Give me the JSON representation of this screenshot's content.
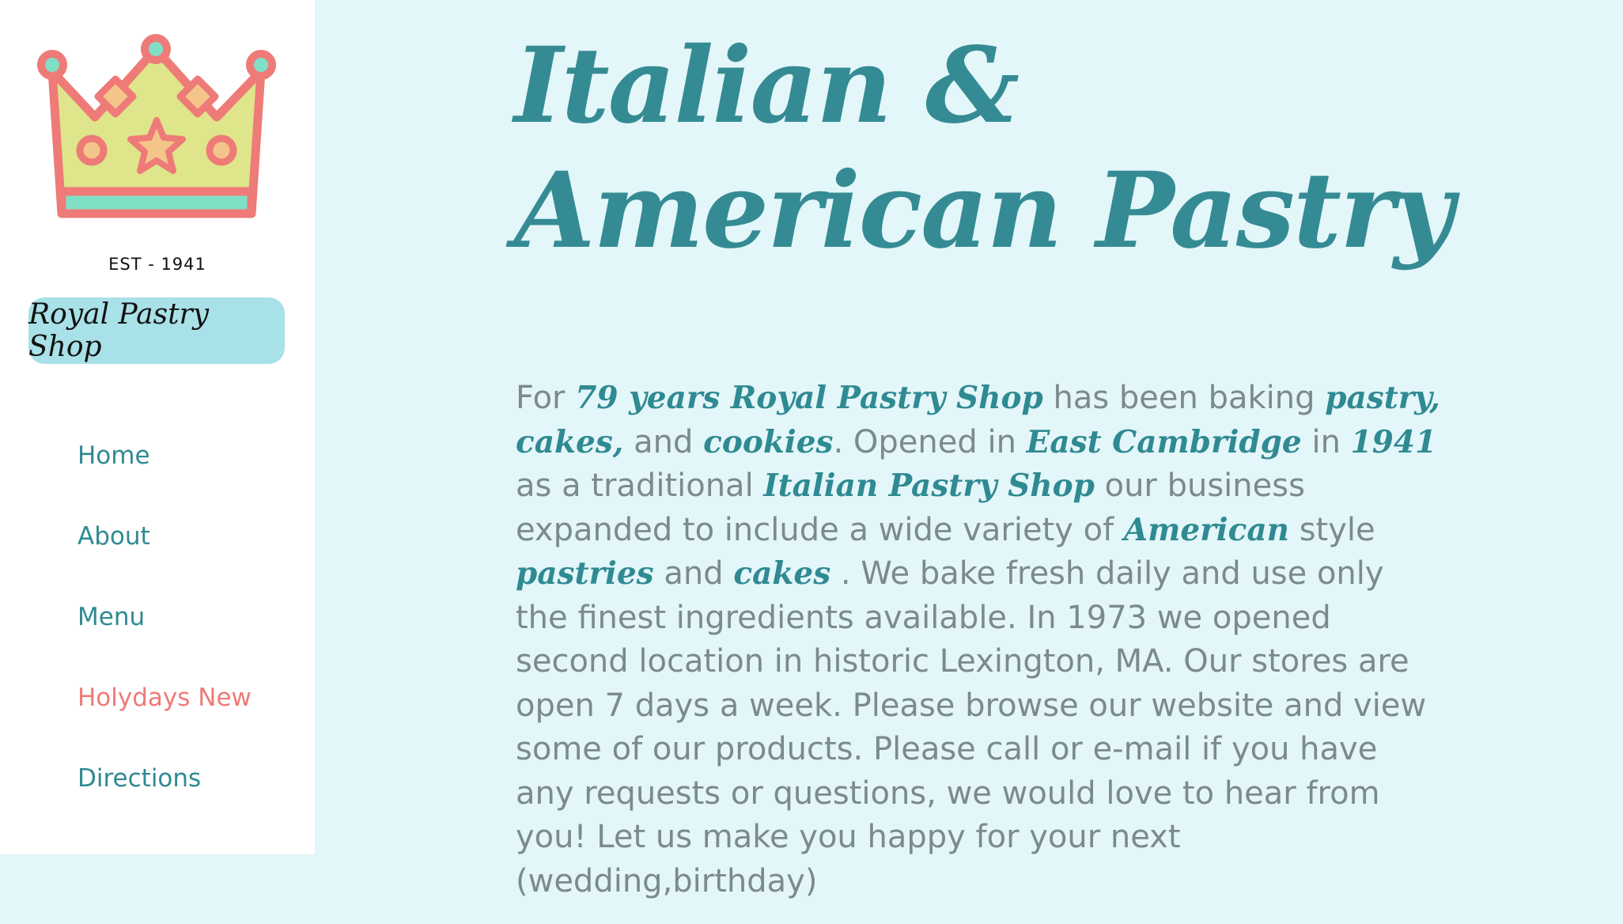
{
  "sidebar": {
    "est": "EST - 1941",
    "shop_name": "Royal Pastry Shop",
    "logo_icon": "crown-icon",
    "nav": {
      "home": "Home",
      "about": "About",
      "menu": "Menu",
      "holidays": "Holydays New",
      "directions": "Directions"
    }
  },
  "main": {
    "title": "Italian & American Pastry",
    "intro": {
      "t1": "For ",
      "h1": "79 years Royal Pastry Shop",
      "t2": " has been baking ",
      "h2": "pastry, cakes,",
      "t3": " and ",
      "h3": "cookies",
      "t4": ". Opened in ",
      "h4": "East Cambridge",
      "t5": " in ",
      "h5": "1941",
      "t6": " as a traditional ",
      "h6": "Italian Pastry Shop",
      "t7": " our business expanded to include a wide variety of ",
      "h7": "American",
      "t8": " style ",
      "h8": "pastries",
      "t9": " and ",
      "h9": "cakes",
      "t10": " . We bake fresh daily and use only the finest ingredients available. In 1973 we opened second location in historic Lexington, MA. Our stores are open 7 days a week. Please browse our website and view some of our products. Please call or e-mail if you have any requests or questions, we would love to hear from you! Let us make you happy for your next (wedding,birthday)"
    }
  },
  "colors": {
    "page_bg": "#e3f6f9",
    "sidebar_bg": "#ffffff",
    "accent_teal": "#2f8a92",
    "accent_coral": "#ee7b78",
    "shop_badge_bg": "#a8e1e7",
    "body_text": "#7b8b8d",
    "crown_fill": "#dfe58a",
    "crown_outline": "#ee7b78",
    "crown_jewel": "#f4c58a",
    "crown_mint": "#7fe0c6"
  }
}
